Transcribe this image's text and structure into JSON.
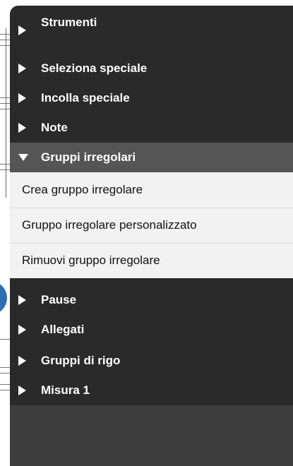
{
  "panel": {
    "header": {
      "label": "Strumenti",
      "expanded": false
    },
    "items_before": [
      {
        "label": "Seleziona speciale",
        "expanded": false
      },
      {
        "label": "Incolla speciale",
        "expanded": false
      },
      {
        "label": "Note",
        "expanded": false
      }
    ],
    "selected": {
      "label": "Gruppi irregolari",
      "expanded": true
    },
    "sub_items": [
      {
        "label": "Crea gruppo irregolare"
      },
      {
        "label": "Gruppo irregolare personalizzato"
      },
      {
        "label": "Rimuovi gruppo irregolare"
      }
    ],
    "items_after": [
      {
        "label": "Pause",
        "expanded": false
      },
      {
        "label": "Allegati",
        "expanded": false
      },
      {
        "label": "Gruppi di rigo",
        "expanded": false
      },
      {
        "label": "Misura 1",
        "expanded": false
      }
    ]
  },
  "colors": {
    "panel_bg": "#2a2a2a",
    "selected_bg": "#555555",
    "submenu_bg": "#f2f2f2",
    "footer_bg": "#3d3d3d",
    "text_light": "#ffffff",
    "text_dark": "#111111"
  },
  "icons": {
    "collapsed": "triangle-right-icon",
    "expanded": "triangle-down-icon"
  }
}
